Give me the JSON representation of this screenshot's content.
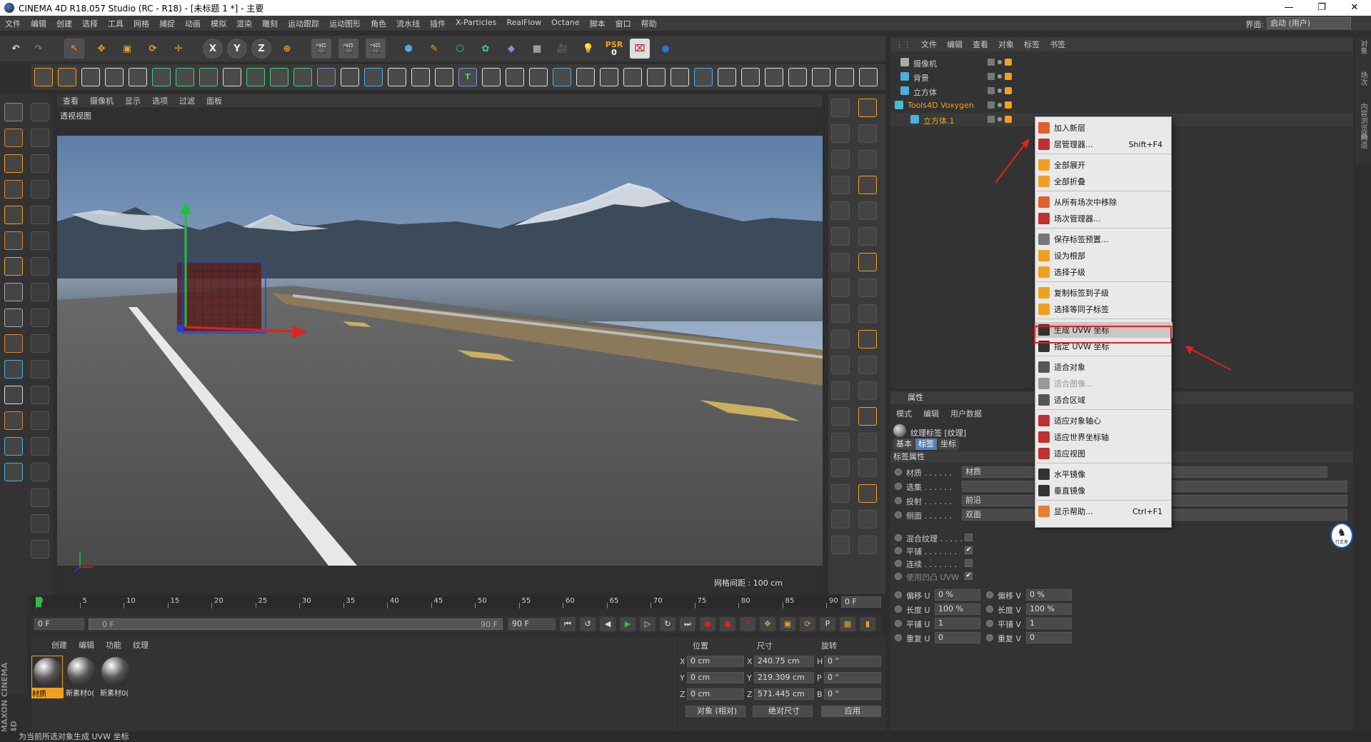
{
  "titlebar": {
    "title": "CINEMA 4D R18.057 Studio (RC - R18) - [未标题 1 *] - 主要",
    "min": "—",
    "max": "❐",
    "close": "✕"
  },
  "menubar": {
    "items": [
      "文件",
      "编辑",
      "创建",
      "选择",
      "工具",
      "网格",
      "捕捉",
      "动画",
      "模拟",
      "渲染",
      "雕刻",
      "运动跟踪",
      "运动图形",
      "角色",
      "流水线",
      "插件",
      "X-Particles",
      "RealFlow",
      "Octane",
      "脚本",
      "窗口",
      "帮助"
    ],
    "layout_label": "界面:",
    "layout_value": "启动 (用户)"
  },
  "toolbar": {
    "x": "X",
    "y": "Y",
    "z": "Z",
    "psr": "PSR",
    "psr_val": "0",
    "t": "T"
  },
  "viewport": {
    "menu": [
      "查看",
      "摄像机",
      "显示",
      "选项",
      "过滤",
      "面板"
    ],
    "label": "透视视图",
    "grid": "网格间距 : 100 cm"
  },
  "objmgr": {
    "menu": [
      "文件",
      "编辑",
      "查看",
      "对象",
      "标签",
      "书签"
    ],
    "rows": [
      {
        "name": "摄像机"
      },
      {
        "name": "背景"
      },
      {
        "name": "立方体"
      },
      {
        "name": "Tools4D Voxygen"
      },
      {
        "name": "立方体.1"
      }
    ]
  },
  "context_menu": {
    "items": [
      {
        "label": "加入新层",
        "shortcut": ""
      },
      {
        "label": "层管理器...",
        "shortcut": "Shift+F4"
      },
      {
        "label": "全部展开",
        "shortcut": ""
      },
      {
        "label": "全部折叠",
        "shortcut": ""
      },
      {
        "label": "从所有场次中移除",
        "shortcut": ""
      },
      {
        "label": "场次管理器...",
        "shortcut": ""
      },
      {
        "label": "保存标签预置...",
        "shortcut": ""
      },
      {
        "label": "设为根部",
        "shortcut": ""
      },
      {
        "label": "选择子级",
        "shortcut": ""
      },
      {
        "label": "复制标签到子级",
        "shortcut": ""
      },
      {
        "label": "选择等同子标签",
        "shortcut": ""
      },
      {
        "label": "生成 UVW 坐标",
        "shortcut": ""
      },
      {
        "label": "指定 UVW 坐标",
        "shortcut": ""
      },
      {
        "label": "适合对象",
        "shortcut": ""
      },
      {
        "label": "适合图像...",
        "shortcut": ""
      },
      {
        "label": "适合区域",
        "shortcut": ""
      },
      {
        "label": "适应对象轴心",
        "shortcut": ""
      },
      {
        "label": "适应世界坐标轴",
        "shortcut": ""
      },
      {
        "label": "适应视图",
        "shortcut": ""
      },
      {
        "label": "水平镜像",
        "shortcut": ""
      },
      {
        "label": "垂直镜像",
        "shortcut": ""
      },
      {
        "label": "显示帮助...",
        "shortcut": "Ctrl+F1"
      }
    ]
  },
  "attr": {
    "header": "属性",
    "menu": [
      "模式",
      "编辑",
      "用户数据"
    ],
    "tag_title": "纹理标签 [纹理]",
    "tabs": [
      "基本",
      "标签",
      "坐标"
    ],
    "section": "标签属性",
    "props": {
      "material_label": "材质 . . . . . .",
      "material_value": "材质",
      "selection_label": "选集 . . . . . .",
      "projection_label": "投射 . . . . . .",
      "projection_value": "前沿",
      "side_label": "侧面 . . . . . .",
      "side_value": "双面",
      "mix_label": "混合纹理 . . . . .",
      "tile_label": "平铺 . . . . . . .",
      "tile_check": "✔",
      "seamless_label": "连续 . . . . . . .",
      "uvw_label": "使用凹凸 UVW",
      "uvw_check": "✔"
    },
    "uv": [
      {
        "l1": "偏移 U",
        "v1": "0 %",
        "l2": "偏移 V",
        "v2": "0 %"
      },
      {
        "l1": "长度 U",
        "v1": "100 %",
        "l2": "长度 V",
        "v2": "100 %"
      },
      {
        "l1": "平铺 U",
        "v1": "1",
        "l2": "平铺 V",
        "v2": "1"
      },
      {
        "l1": "重复 U",
        "v1": "0",
        "l2": "重复 V",
        "v2": "0"
      }
    ]
  },
  "timeline": {
    "ticks": [
      "0",
      "5",
      "10",
      "15",
      "20",
      "25",
      "30",
      "35",
      "40",
      "45",
      "50",
      "55",
      "60",
      "65",
      "70",
      "75",
      "80",
      "85",
      "90"
    ],
    "frame": "0 F",
    "start": "0 F",
    "range_left": "0 F",
    "range_right": "90 F",
    "end": "90 F",
    "end2": "90 F"
  },
  "matmgr": {
    "menu": [
      "创建",
      "编辑",
      "功能",
      "纹理"
    ],
    "materials": [
      "材质",
      "新素材0(",
      "新素材0("
    ]
  },
  "coord": {
    "headers": [
      "位置",
      "尺寸",
      "旋转"
    ],
    "rows": [
      {
        "a": "X",
        "pos": "0 cm",
        "b": "X",
        "size": "240.75 cm",
        "c": "H",
        "rot": "0 °"
      },
      {
        "a": "Y",
        "pos": "0 cm",
        "b": "Y",
        "size": "219.309 cm",
        "c": "P",
        "rot": "0 °"
      },
      {
        "a": "Z",
        "pos": "0 cm",
        "b": "Z",
        "size": "571.445 cm",
        "c": "B",
        "rot": "0 °"
      }
    ],
    "mode1": "对象 (相对)",
    "mode2": "绝对尺寸",
    "apply": "应用"
  },
  "status": "为当前所选对象生成 UVW 坐标",
  "sidetabs": [
    "对象",
    "场次",
    "内容浏览器",
    "构造"
  ],
  "brand": "MAXON CINEMA 4D",
  "logo_text": "行走者"
}
